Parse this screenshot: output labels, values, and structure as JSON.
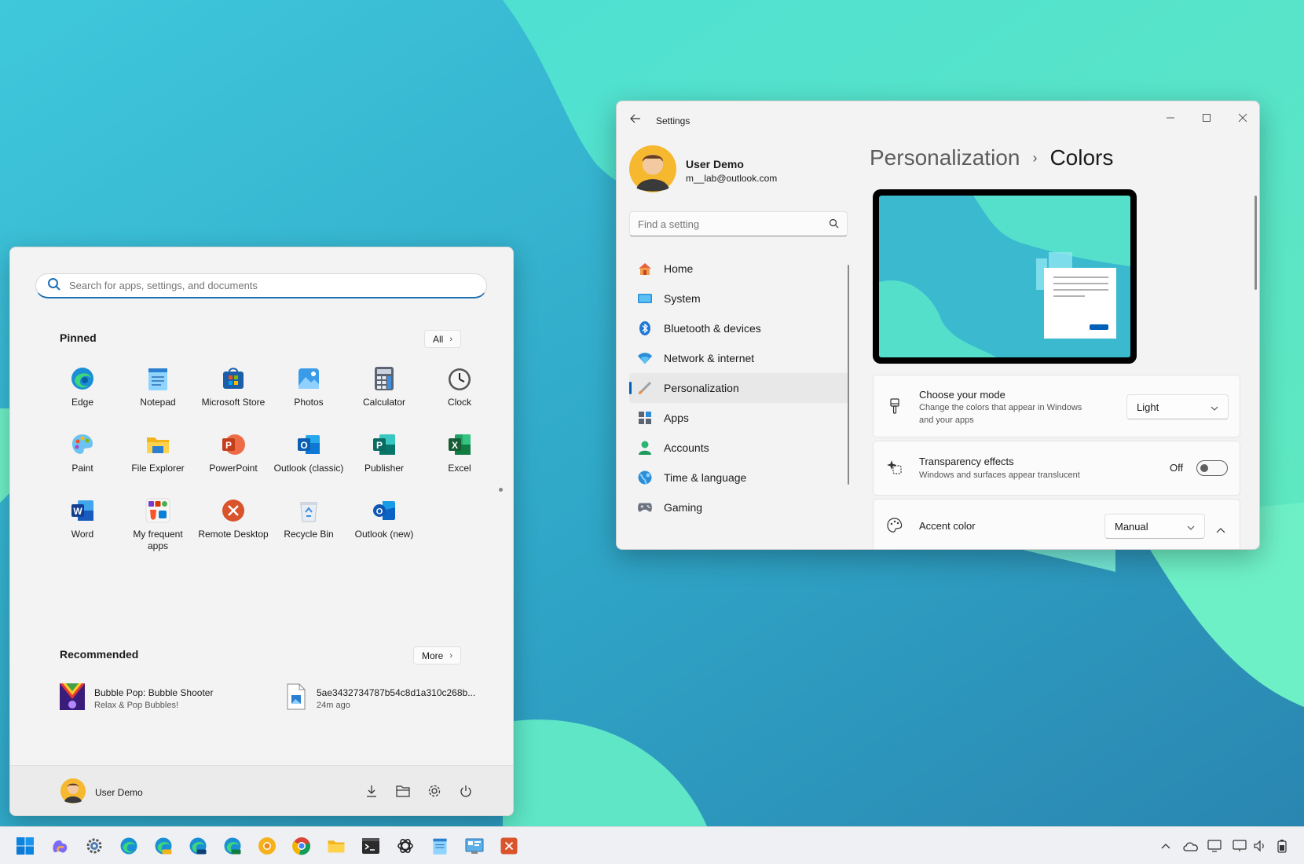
{
  "start_menu": {
    "search_placeholder": "Search for apps, settings, and documents",
    "pinned_title": "Pinned",
    "all_button": "All",
    "pinned_apps": [
      {
        "label": "Edge",
        "icon": "edge-icon"
      },
      {
        "label": "Notepad",
        "icon": "notepad-icon"
      },
      {
        "label": "Microsoft Store",
        "icon": "store-icon"
      },
      {
        "label": "Photos",
        "icon": "photos-icon"
      },
      {
        "label": "Calculator",
        "icon": "calculator-icon"
      },
      {
        "label": "Clock",
        "icon": "clock-icon"
      },
      {
        "label": "Paint",
        "icon": "paint-icon"
      },
      {
        "label": "File Explorer",
        "icon": "folder-icon"
      },
      {
        "label": "PowerPoint",
        "icon": "powerpoint-icon"
      },
      {
        "label": "Outlook (classic)",
        "icon": "outlook-icon"
      },
      {
        "label": "Publisher",
        "icon": "publisher-icon"
      },
      {
        "label": "Excel",
        "icon": "excel-icon"
      },
      {
        "label": "Word",
        "icon": "word-icon"
      },
      {
        "label": "My frequent apps",
        "icon": "folder-group-icon"
      },
      {
        "label": "Remote Desktop",
        "icon": "remote-desktop-icon"
      },
      {
        "label": "Recycle Bin",
        "icon": "recycle-bin-icon"
      },
      {
        "label": "Outlook (new)",
        "icon": "outlook-new-icon"
      }
    ],
    "recommended_title": "Recommended",
    "more_button": "More",
    "recommended": [
      {
        "title": "Bubble Pop: Bubble Shooter",
        "subtitle": "Relax & Pop Bubbles!",
        "icon": "game-icon"
      },
      {
        "title": "5ae3432734787b54c8d1a310c268b...",
        "subtitle": "24m ago",
        "icon": "image-file-icon"
      }
    ],
    "user_name": "User Demo"
  },
  "settings": {
    "window_title": "Settings",
    "user_name": "User Demo",
    "user_email": "m__lab@outlook.com",
    "find_placeholder": "Find a setting",
    "nav": [
      {
        "label": "Home",
        "icon": "home-icon"
      },
      {
        "label": "System",
        "icon": "system-icon"
      },
      {
        "label": "Bluetooth & devices",
        "icon": "bluetooth-icon"
      },
      {
        "label": "Network & internet",
        "icon": "wifi-icon"
      },
      {
        "label": "Personalization",
        "icon": "brush-icon"
      },
      {
        "label": "Apps",
        "icon": "apps-icon"
      },
      {
        "label": "Accounts",
        "icon": "accounts-icon"
      },
      {
        "label": "Time & language",
        "icon": "globe-icon"
      },
      {
        "label": "Gaming",
        "icon": "gamepad-icon"
      }
    ],
    "active_nav": "Personalization",
    "breadcrumb_parent": "Personalization",
    "breadcrumb_current": "Colors",
    "mode_title": "Choose your mode",
    "mode_desc_1": "Change the colors that appear in Windows",
    "mode_desc_2": "and your apps",
    "mode_value": "Light",
    "transparency_title": "Transparency effects",
    "transparency_desc": "Windows and surfaces appear translucent",
    "transparency_state": "Off",
    "accent_title": "Accent color",
    "accent_value": "Manual"
  },
  "colors": {
    "accent": "#005fb8",
    "wallpaper_teal": "#3ec9d6",
    "wallpaper_mint": "#55e6c8"
  }
}
